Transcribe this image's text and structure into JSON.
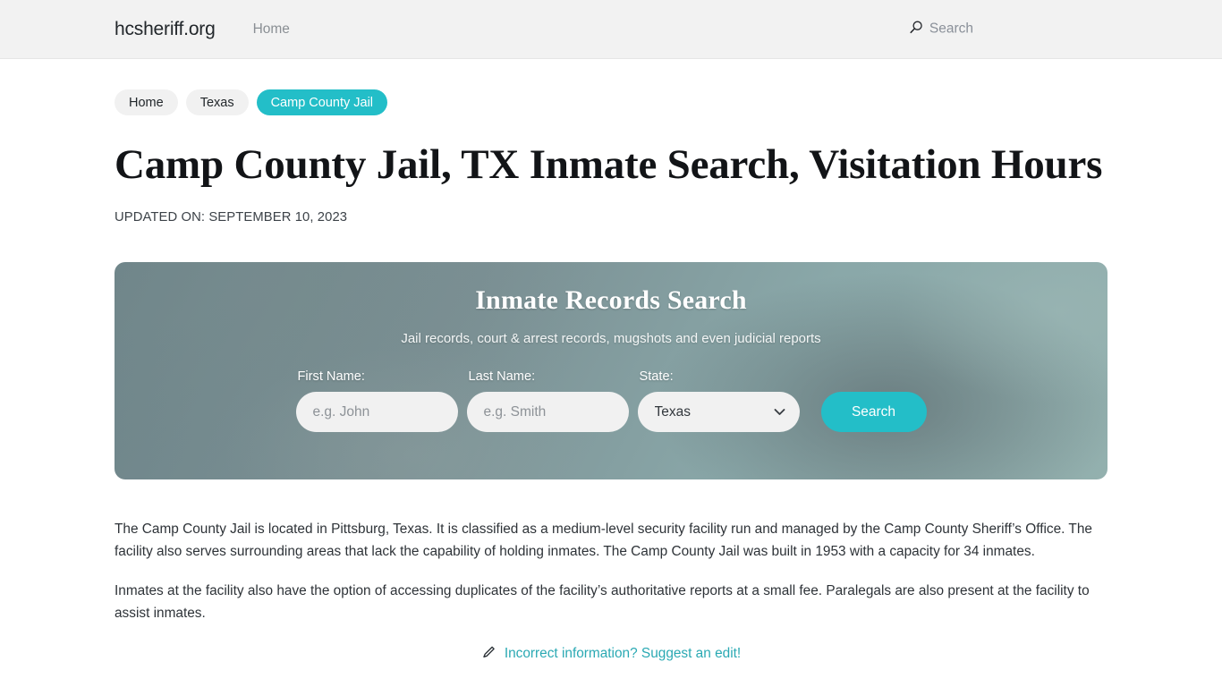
{
  "header": {
    "brand": "hcsheriff.org",
    "nav": [
      {
        "label": "Home"
      }
    ],
    "search": {
      "label": "Search",
      "icon": "search-icon"
    }
  },
  "breadcrumb": [
    {
      "label": "Home",
      "active": false
    },
    {
      "label": "Texas",
      "active": false
    },
    {
      "label": "Camp County Jail",
      "active": true
    }
  ],
  "main": {
    "title": "Camp County Jail, TX Inmate Search, Visitation Hours",
    "updated": "UPDATED ON: SEPTEMBER 10, 2023"
  },
  "search_card": {
    "title": "Inmate Records Search",
    "subtitle": "Jail records, court & arrest records, mugshots and even judicial reports",
    "fields": {
      "first_name": {
        "label": "First Name:",
        "placeholder": "e.g. John",
        "value": ""
      },
      "last_name": {
        "label": "Last Name:",
        "placeholder": "e.g. Smith",
        "value": ""
      },
      "state": {
        "label": "State:",
        "value": "Texas",
        "options": [
          "Texas"
        ]
      }
    },
    "submit_label": "Search"
  },
  "content": {
    "paragraph_1_a": "The Camp County Jail is located in Pittsburg, Texas. It is classified as a medium-level security facility run and managed by the Camp County Sheriff’s Office. The facility also serves surrounding areas that lack the capability of holding inmates. The Camp County Jail was built in 1953 with a capacity for 34 inmates.",
    "paragraph_2_a": "Inmates at the ",
    "paragraph_2_link": "facility",
    "paragraph_2_b": " also have the option of accessing duplicates of the facility’s authoritative reports at a small fee. Paralegals are also present at the facility to assist inmates."
  },
  "suggest_edit": {
    "label": "Incorrect information? Suggest an edit!",
    "icon": "pencil-icon"
  },
  "colors": {
    "accent_teal": "#23bec8",
    "link_teal": "#2aa9b3",
    "header_bg": "#f2f2f2",
    "input_bg": "#f1f1f1",
    "pill_bg": "#f1f1f1",
    "text_dark": "#22272b"
  }
}
